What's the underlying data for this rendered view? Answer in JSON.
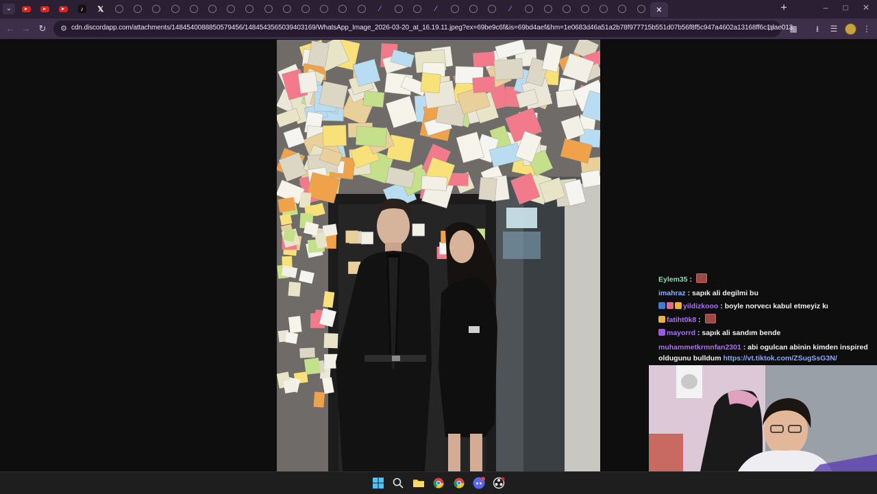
{
  "browser": {
    "tabs": [
      {
        "icon": "youtube-icon"
      },
      {
        "icon": "youtube-icon"
      },
      {
        "icon": "youtube-icon"
      },
      {
        "icon": "tiktok-icon"
      },
      {
        "icon": "x-icon"
      },
      {
        "icon": "globe-icon"
      },
      {
        "icon": "globe-icon"
      },
      {
        "icon": "globe-icon"
      },
      {
        "icon": "globe-icon"
      },
      {
        "icon": "globe-icon"
      },
      {
        "icon": "globe-icon"
      },
      {
        "icon": "globe-icon"
      },
      {
        "icon": "globe-icon"
      },
      {
        "icon": "globe-icon"
      },
      {
        "icon": "globe-icon"
      },
      {
        "icon": "globe-icon"
      },
      {
        "icon": "globe-icon"
      },
      {
        "icon": "globe-icon"
      },
      {
        "icon": "globe-icon"
      },
      {
        "icon": "twitch-icon"
      },
      {
        "icon": "globe-icon"
      },
      {
        "icon": "globe-icon"
      },
      {
        "icon": "twitch-icon"
      },
      {
        "icon": "globe-icon"
      },
      {
        "icon": "globe-icon"
      },
      {
        "icon": "globe-icon"
      },
      {
        "icon": "twitch-icon"
      },
      {
        "icon": "globe-icon"
      },
      {
        "icon": "globe-icon"
      },
      {
        "icon": "globe-icon"
      },
      {
        "icon": "globe-icon"
      },
      {
        "icon": "globe-icon"
      },
      {
        "icon": "globe-icon"
      },
      {
        "icon": "globe-icon"
      }
    ],
    "url": "cdn.discordapp.com/attachments/1484540088850579456/1484543565039403169/WhatsApp_Image_2026-03-20_at_16.19.11.jpeg?ex=69be9c6f&is=69bd4aef&hm=1e0683d46a51a2b78f977715b551d07b56f8f5c947a4602a13168ff6c1dae013",
    "accent_color": "#3d2e49"
  },
  "chat": {
    "messages": [
      {
        "user": "Eylem35",
        "user_color": "#8fd9b6",
        "text": "",
        "emote": true,
        "badges": []
      },
      {
        "user": "imahraz",
        "user_color": "#8ab4f8",
        "text": "sapık ali degilmi bu",
        "emote": false,
        "badges": []
      },
      {
        "user": "yildizkooo",
        "user_color": "#a970ff",
        "text": "boyle norvecı kabul etmeyiz kı",
        "emote": false,
        "badges": [
          "#3b7dd8",
          "#e06b8b",
          "#e8b339"
        ]
      },
      {
        "user": "fatiht0k8",
        "user_color": "#a970ff",
        "text": "",
        "emote": true,
        "badges": [
          "#e8b339"
        ]
      },
      {
        "user": "mayorrd",
        "user_color": "#a970ff",
        "text": "sapık ali sandım bende",
        "emote": false,
        "badges": [
          "#9b59e6"
        ]
      },
      {
        "user": "muhammetkrmnfan2301",
        "user_color": "#a970ff",
        "text": "abi ogulcan abinin kimden inspired oldugunu bulldum",
        "link": "https://vt.tiktok.com/ZSugSsG3N/",
        "emote": false,
        "badges": []
      }
    ]
  },
  "taskbar": {
    "icons": [
      "windows-start-icon",
      "search-icon",
      "file-explorer-icon",
      "chrome-icon",
      "chrome-icon",
      "discord-icon",
      "obs-icon"
    ]
  }
}
